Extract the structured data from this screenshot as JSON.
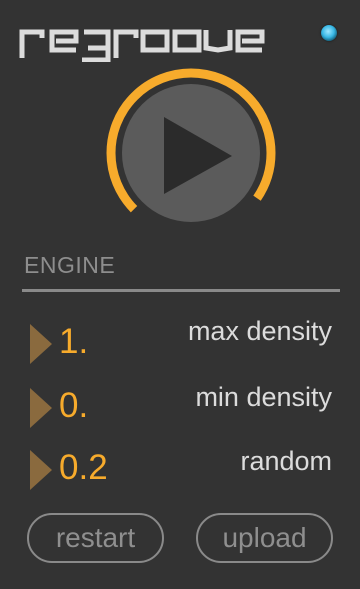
{
  "app": {
    "title": "regroove"
  },
  "colors": {
    "background": "#333333",
    "accent": "#f7ab2c",
    "arrow": "#8a6a3e",
    "label": "#dcdcdc",
    "muted": "#8e8e8e",
    "led": "#39b8e6"
  },
  "icons": {
    "logo": "regroove-wordmark",
    "status": "status-led",
    "play": "play-icon",
    "expand": "triangle-right-icon"
  },
  "engine": {
    "section_label": "ENGINE",
    "params": [
      {
        "value": "1.",
        "label": "max density"
      },
      {
        "value": "0.",
        "label": "min density"
      },
      {
        "value": "0.2",
        "label": "random"
      }
    ]
  },
  "buttons": {
    "restart": "restart",
    "upload": "upload"
  }
}
